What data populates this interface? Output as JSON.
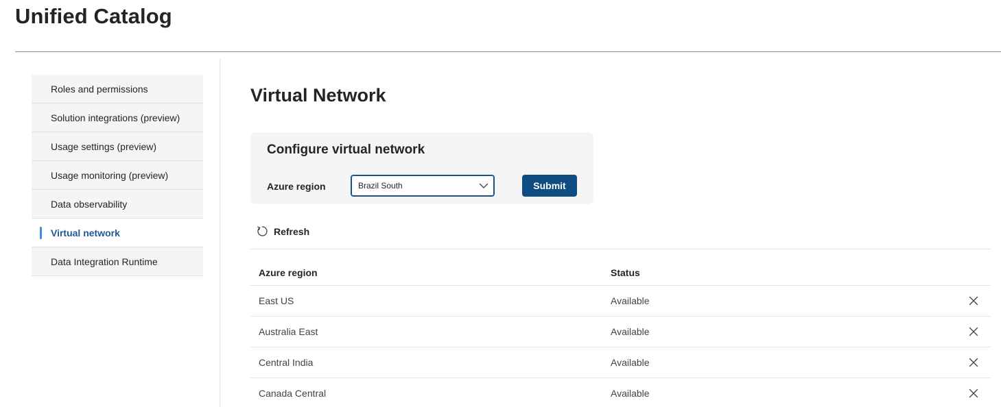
{
  "app": {
    "title": "Unified Catalog"
  },
  "sidebar": {
    "items": [
      {
        "label": "Roles and permissions",
        "active": false
      },
      {
        "label": "Solution integrations (preview)",
        "active": false
      },
      {
        "label": "Usage settings (preview)",
        "active": false
      },
      {
        "label": "Usage monitoring (preview)",
        "active": false
      },
      {
        "label": "Data observability",
        "active": false
      },
      {
        "label": "Virtual network",
        "active": true
      },
      {
        "label": "Data Integration Runtime",
        "active": false
      }
    ]
  },
  "main": {
    "title": "Virtual Network",
    "config": {
      "title": "Configure virtual network",
      "region_label": "Azure region",
      "region_selected": "Brazil South",
      "submit_label": "Submit"
    },
    "toolbar": {
      "refresh_label": "Refresh"
    },
    "table": {
      "columns": [
        "Azure region",
        "Status"
      ],
      "rows": [
        {
          "region": "East US",
          "status": "Available"
        },
        {
          "region": "Australia East",
          "status": "Available"
        },
        {
          "region": "Central India",
          "status": "Available"
        },
        {
          "region": "Canada Central",
          "status": "Available"
        }
      ]
    }
  },
  "colors": {
    "accent": "#0f4c81",
    "active_nav_text": "#1e5a96",
    "active_nav_marker": "#3a8ee6",
    "sidebar_bg": "#f5f5f5",
    "card_bg": "#f5f5f5"
  },
  "icons": {
    "dropdown": "chevron-down-icon",
    "refresh": "refresh-icon",
    "remove": "close-icon"
  }
}
